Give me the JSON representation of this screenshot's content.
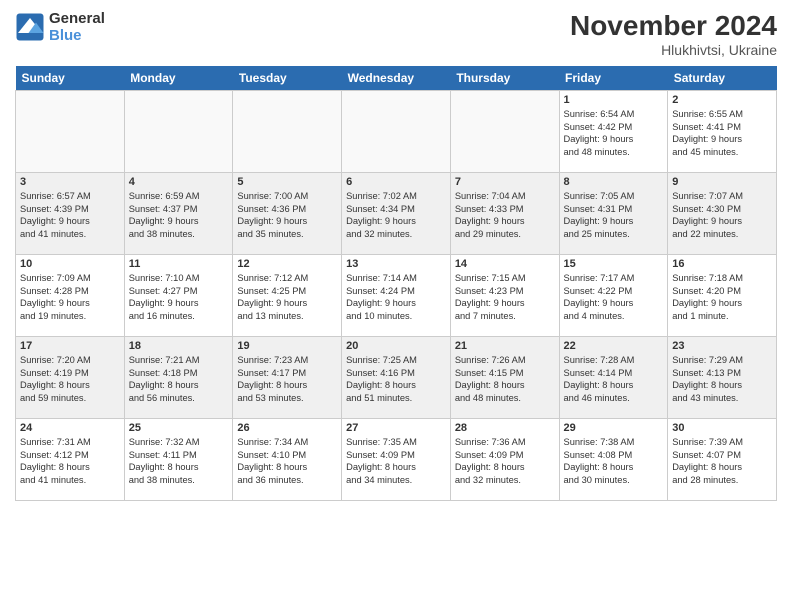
{
  "logo": {
    "line1": "General",
    "line2": "Blue"
  },
  "title": "November 2024",
  "location": "Hlukhivtsi, Ukraine",
  "days_of_week": [
    "Sunday",
    "Monday",
    "Tuesday",
    "Wednesday",
    "Thursday",
    "Friday",
    "Saturday"
  ],
  "weeks": [
    [
      {
        "day": "",
        "info": "",
        "empty": true
      },
      {
        "day": "",
        "info": "",
        "empty": true
      },
      {
        "day": "",
        "info": "",
        "empty": true
      },
      {
        "day": "",
        "info": "",
        "empty": true
      },
      {
        "day": "",
        "info": "",
        "empty": true
      },
      {
        "day": "1",
        "info": "Sunrise: 6:54 AM\nSunset: 4:42 PM\nDaylight: 9 hours\nand 48 minutes.",
        "empty": false
      },
      {
        "day": "2",
        "info": "Sunrise: 6:55 AM\nSunset: 4:41 PM\nDaylight: 9 hours\nand 45 minutes.",
        "empty": false
      }
    ],
    [
      {
        "day": "3",
        "info": "Sunrise: 6:57 AM\nSunset: 4:39 PM\nDaylight: 9 hours\nand 41 minutes.",
        "empty": false
      },
      {
        "day": "4",
        "info": "Sunrise: 6:59 AM\nSunset: 4:37 PM\nDaylight: 9 hours\nand 38 minutes.",
        "empty": false
      },
      {
        "day": "5",
        "info": "Sunrise: 7:00 AM\nSunset: 4:36 PM\nDaylight: 9 hours\nand 35 minutes.",
        "empty": false
      },
      {
        "day": "6",
        "info": "Sunrise: 7:02 AM\nSunset: 4:34 PM\nDaylight: 9 hours\nand 32 minutes.",
        "empty": false
      },
      {
        "day": "7",
        "info": "Sunrise: 7:04 AM\nSunset: 4:33 PM\nDaylight: 9 hours\nand 29 minutes.",
        "empty": false
      },
      {
        "day": "8",
        "info": "Sunrise: 7:05 AM\nSunset: 4:31 PM\nDaylight: 9 hours\nand 25 minutes.",
        "empty": false
      },
      {
        "day": "9",
        "info": "Sunrise: 7:07 AM\nSunset: 4:30 PM\nDaylight: 9 hours\nand 22 minutes.",
        "empty": false
      }
    ],
    [
      {
        "day": "10",
        "info": "Sunrise: 7:09 AM\nSunset: 4:28 PM\nDaylight: 9 hours\nand 19 minutes.",
        "empty": false
      },
      {
        "day": "11",
        "info": "Sunrise: 7:10 AM\nSunset: 4:27 PM\nDaylight: 9 hours\nand 16 minutes.",
        "empty": false
      },
      {
        "day": "12",
        "info": "Sunrise: 7:12 AM\nSunset: 4:25 PM\nDaylight: 9 hours\nand 13 minutes.",
        "empty": false
      },
      {
        "day": "13",
        "info": "Sunrise: 7:14 AM\nSunset: 4:24 PM\nDaylight: 9 hours\nand 10 minutes.",
        "empty": false
      },
      {
        "day": "14",
        "info": "Sunrise: 7:15 AM\nSunset: 4:23 PM\nDaylight: 9 hours\nand 7 minutes.",
        "empty": false
      },
      {
        "day": "15",
        "info": "Sunrise: 7:17 AM\nSunset: 4:22 PM\nDaylight: 9 hours\nand 4 minutes.",
        "empty": false
      },
      {
        "day": "16",
        "info": "Sunrise: 7:18 AM\nSunset: 4:20 PM\nDaylight: 9 hours\nand 1 minute.",
        "empty": false
      }
    ],
    [
      {
        "day": "17",
        "info": "Sunrise: 7:20 AM\nSunset: 4:19 PM\nDaylight: 8 hours\nand 59 minutes.",
        "empty": false
      },
      {
        "day": "18",
        "info": "Sunrise: 7:21 AM\nSunset: 4:18 PM\nDaylight: 8 hours\nand 56 minutes.",
        "empty": false
      },
      {
        "day": "19",
        "info": "Sunrise: 7:23 AM\nSunset: 4:17 PM\nDaylight: 8 hours\nand 53 minutes.",
        "empty": false
      },
      {
        "day": "20",
        "info": "Sunrise: 7:25 AM\nSunset: 4:16 PM\nDaylight: 8 hours\nand 51 minutes.",
        "empty": false
      },
      {
        "day": "21",
        "info": "Sunrise: 7:26 AM\nSunset: 4:15 PM\nDaylight: 8 hours\nand 48 minutes.",
        "empty": false
      },
      {
        "day": "22",
        "info": "Sunrise: 7:28 AM\nSunset: 4:14 PM\nDaylight: 8 hours\nand 46 minutes.",
        "empty": false
      },
      {
        "day": "23",
        "info": "Sunrise: 7:29 AM\nSunset: 4:13 PM\nDaylight: 8 hours\nand 43 minutes.",
        "empty": false
      }
    ],
    [
      {
        "day": "24",
        "info": "Sunrise: 7:31 AM\nSunset: 4:12 PM\nDaylight: 8 hours\nand 41 minutes.",
        "empty": false
      },
      {
        "day": "25",
        "info": "Sunrise: 7:32 AM\nSunset: 4:11 PM\nDaylight: 8 hours\nand 38 minutes.",
        "empty": false
      },
      {
        "day": "26",
        "info": "Sunrise: 7:34 AM\nSunset: 4:10 PM\nDaylight: 8 hours\nand 36 minutes.",
        "empty": false
      },
      {
        "day": "27",
        "info": "Sunrise: 7:35 AM\nSunset: 4:09 PM\nDaylight: 8 hours\nand 34 minutes.",
        "empty": false
      },
      {
        "day": "28",
        "info": "Sunrise: 7:36 AM\nSunset: 4:09 PM\nDaylight: 8 hours\nand 32 minutes.",
        "empty": false
      },
      {
        "day": "29",
        "info": "Sunrise: 7:38 AM\nSunset: 4:08 PM\nDaylight: 8 hours\nand 30 minutes.",
        "empty": false
      },
      {
        "day": "30",
        "info": "Sunrise: 7:39 AM\nSunset: 4:07 PM\nDaylight: 8 hours\nand 28 minutes.",
        "empty": false
      }
    ]
  ]
}
